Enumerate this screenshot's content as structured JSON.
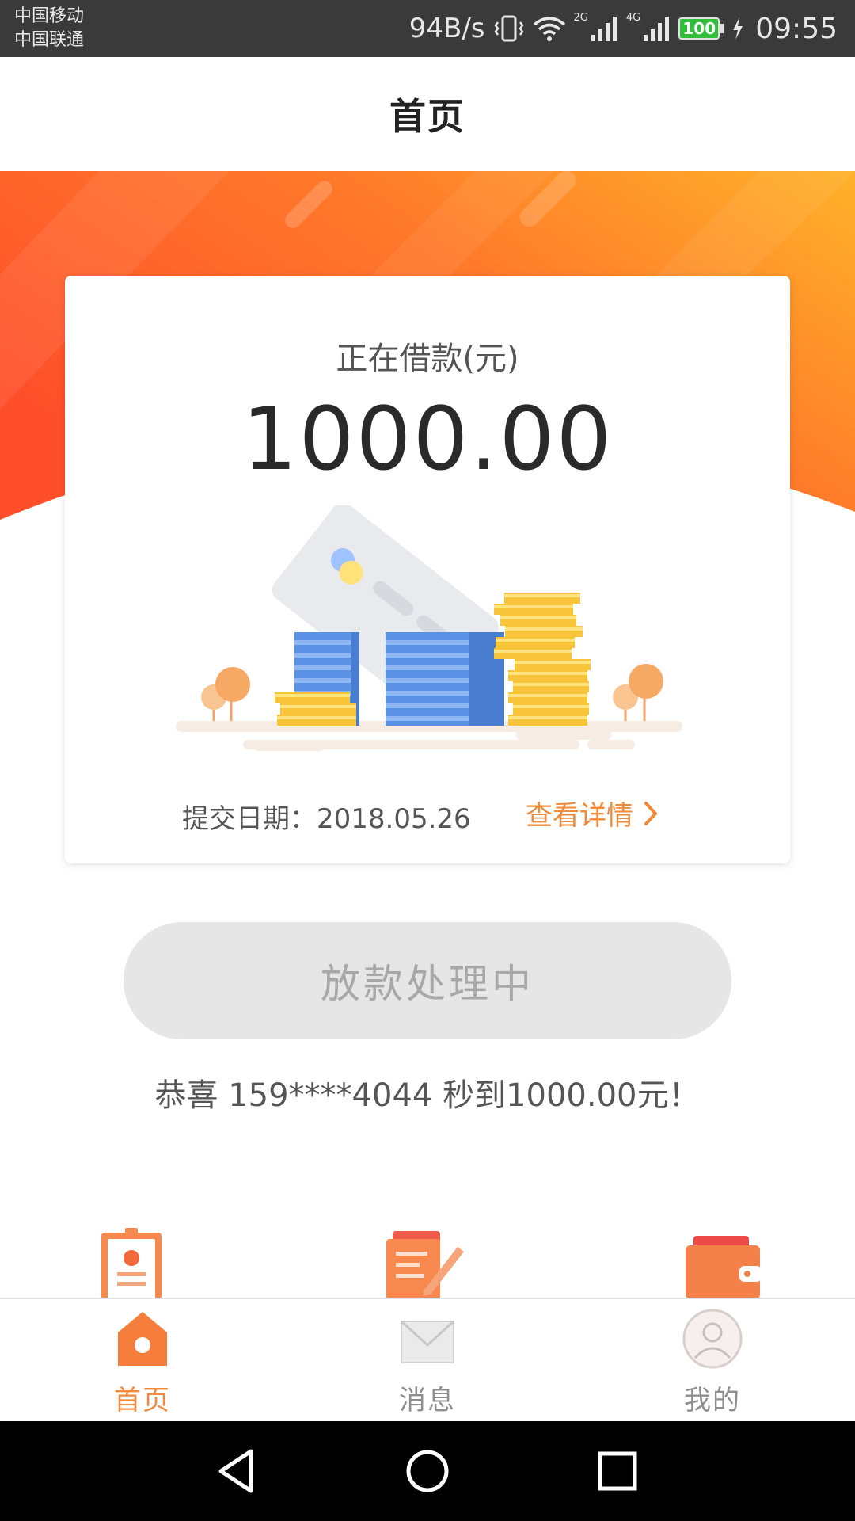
{
  "status_bar": {
    "carrier_1": "中国移动",
    "carrier_2": "中国联通",
    "net_speed": "94B/s",
    "net_2g": "2G",
    "net_4g": "4G",
    "battery": "100",
    "time": "09:55"
  },
  "header": {
    "title": "首页"
  },
  "loan_card": {
    "label": "正在借款(元)",
    "amount": "1000.00",
    "submit_date": "提交日期：2018.05.26",
    "detail_link": "查看详情"
  },
  "status_button": {
    "label": "放款处理中"
  },
  "notice": {
    "text": "恭喜 159****4044 秒到1000.00元！"
  },
  "bottom_nav": {
    "items": [
      {
        "label": "首页",
        "icon": "home-icon",
        "active": true
      },
      {
        "label": "消息",
        "icon": "mail-icon",
        "active": false
      },
      {
        "label": "我的",
        "icon": "user-icon",
        "active": false
      }
    ]
  },
  "colors": {
    "accent": "#f28a3e",
    "banner_start": "#ff5a2a",
    "banner_end": "#ffb028",
    "button_disabled": "#e6e6e6"
  }
}
